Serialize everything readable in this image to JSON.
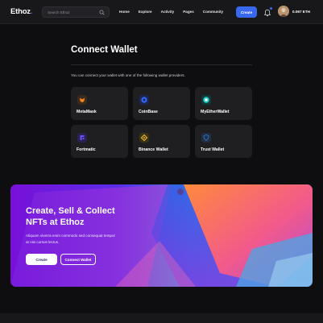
{
  "header": {
    "logo_main": "Ethoz",
    "logo_dot": ".",
    "search_placeholder": "Search Ethoz",
    "nav": [
      "Home",
      "Explore",
      "Activity",
      "Pages",
      "Community"
    ],
    "create_label": "Create",
    "balance": "0.097 ETH"
  },
  "main": {
    "title": "Connect Wallet",
    "intro": "You can connect your wallet with one of the following wallet providers.",
    "wallets": [
      {
        "label": "MetaMask",
        "icon": "metamask-icon",
        "color": "#3a2b1e",
        "accent": "#f6851b"
      },
      {
        "label": "CoinBase",
        "icon": "coinbase-icon",
        "color": "#1d2650",
        "accent": "#2f6bff"
      },
      {
        "label": "MyEtherWallet",
        "icon": "myetherwallet-icon",
        "color": "#123a3a",
        "accent": "#1fc7c2"
      },
      {
        "label": "Fortmatic",
        "icon": "fortmatic-icon",
        "color": "#2b2150",
        "accent": "#6851ff"
      },
      {
        "label": "Binance Wallet",
        "icon": "binance-icon",
        "color": "#3a3212",
        "accent": "#f3ba2f"
      },
      {
        "label": "Trust Wallet",
        "icon": "trustwallet-icon",
        "color": "#1f2d45",
        "accent": "#3375bb"
      }
    ]
  },
  "banner": {
    "title_line1": "Create, Sell & Collect",
    "title_line2": "NFTs at Ethoz",
    "desc_line1": "Aliquam viverra enim commodo sed consequat tempor",
    "desc_line2": "at nisi cursus lectus.",
    "create_label": "Create",
    "connect_label": "Connect Wallet"
  },
  "colors": {
    "accent": "#3867f0",
    "background": "#0e0e10",
    "card": "#1f1f22"
  }
}
